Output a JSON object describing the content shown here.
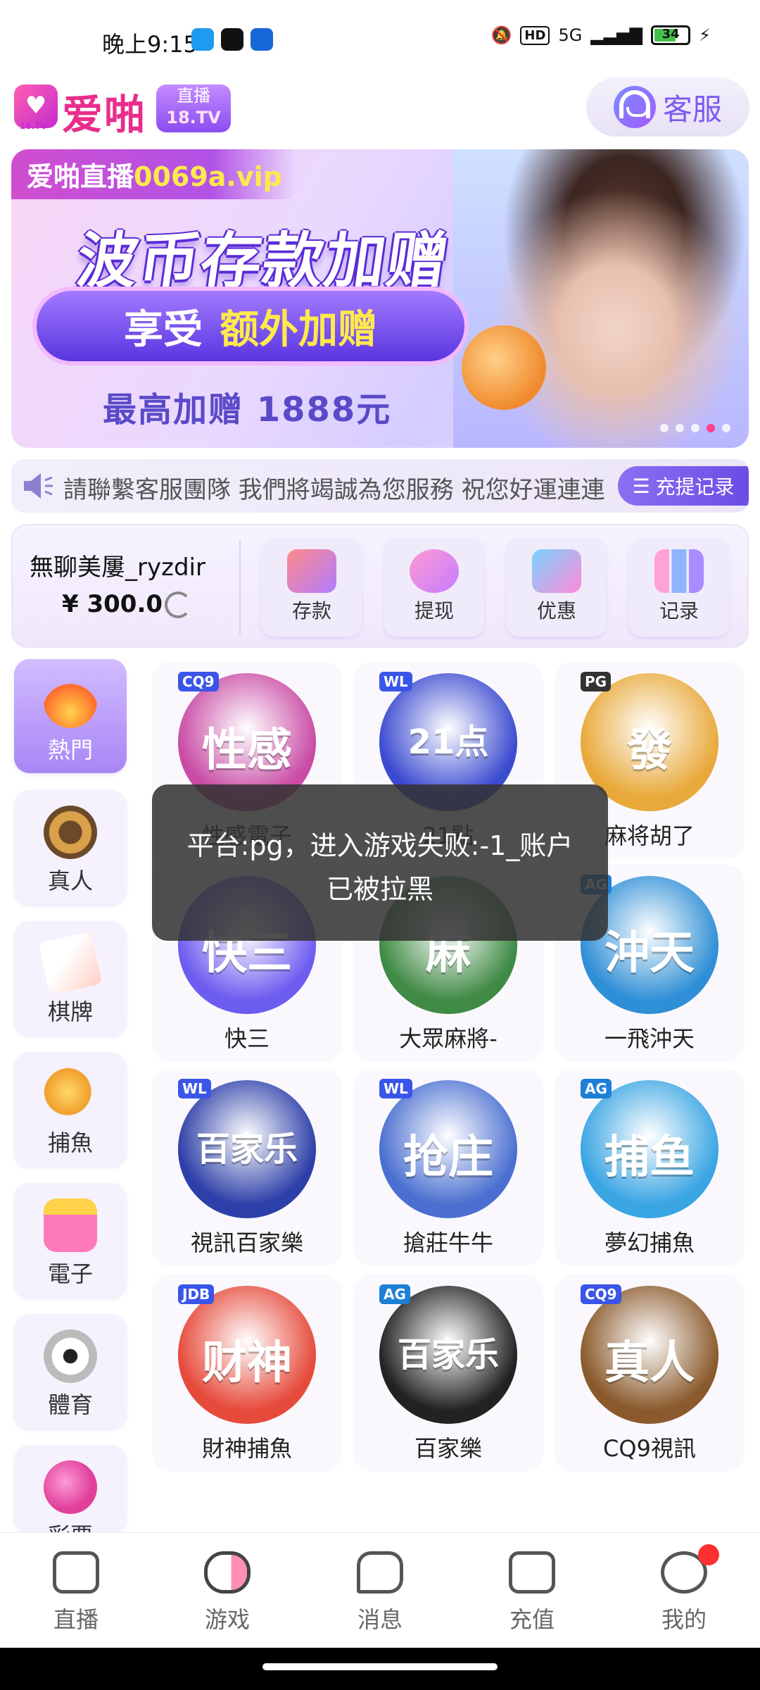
{
  "status_bar": {
    "time": "晚上9:15",
    "network": "5G",
    "hd": "HD",
    "battery": "34"
  },
  "header": {
    "logo_text": "爱啪",
    "logo_tv": "18.TV",
    "badge_top": "直播",
    "badge_bottom": "18.TV",
    "service_label": "客服"
  },
  "banner": {
    "site_prefix": "爱啪直播",
    "site_url": "0069a.vip",
    "title": "波币存款加赠",
    "pill_text_1": "享受",
    "pill_text_2": "额外加赠",
    "footer": "最高加赠 1888元",
    "slide_count": 5,
    "active_slide": 3
  },
  "marquee": {
    "text": "請聯繫客服團隊 我們將竭誠為您服務 祝您好運連連",
    "record_button": "充提记录"
  },
  "account": {
    "username": "無聊美屢_ryzdir",
    "balance": "¥ 300.0",
    "actions": [
      {
        "label": "存款",
        "icon": "deposit-card-icon"
      },
      {
        "label": "提现",
        "icon": "withdraw-bag-icon"
      },
      {
        "label": "优惠",
        "icon": "gift-icon"
      },
      {
        "label": "记录",
        "icon": "bar-chart-icon"
      }
    ]
  },
  "categories": [
    {
      "label": "熱門",
      "icon": "flame-icon",
      "active": true
    },
    {
      "label": "真人",
      "icon": "casino-chip-icon",
      "active": false
    },
    {
      "label": "棋牌",
      "icon": "playing-card-icon",
      "active": false
    },
    {
      "label": "捕魚",
      "icon": "fish-icon",
      "active": false
    },
    {
      "label": "電子",
      "icon": "slot-machine-icon",
      "active": false
    },
    {
      "label": "體育",
      "icon": "soccer-ball-icon",
      "active": false
    },
    {
      "label": "彩票",
      "icon": "lottery-ball-icon",
      "active": false
    }
  ],
  "games": [
    {
      "label": "性感電子",
      "tag": "CQ9",
      "glyph": "性感",
      "color": "#c94ba5"
    },
    {
      "label": "21點",
      "tag": "WL",
      "glyph": "21点",
      "color": "#3b4bd0"
    },
    {
      "label": "麻将胡了",
      "tag": "PG",
      "glyph": "發",
      "color": "#e8a93a"
    },
    {
      "label": "快三",
      "tag": "",
      "glyph": "快三",
      "color": "#6d5cf0"
    },
    {
      "label": "大眾麻將-",
      "tag": "",
      "glyph": "麻",
      "color": "#3f8a44"
    },
    {
      "label": "一飛沖天",
      "tag": "AG",
      "glyph": "沖天",
      "color": "#2f8fd6"
    },
    {
      "label": "視訊百家樂",
      "tag": "WL",
      "glyph": "百家乐",
      "color": "#2d3fa8"
    },
    {
      "label": "搶莊牛牛",
      "tag": "WL",
      "glyph": "抢庄",
      "color": "#4a6fd0"
    },
    {
      "label": "夢幻捕魚",
      "tag": "AG",
      "glyph": "捕鱼",
      "color": "#3aa5e3"
    },
    {
      "label": "財神捕魚",
      "tag": "JDB",
      "glyph": "财神",
      "color": "#e64a3b"
    },
    {
      "label": "百家樂",
      "tag": "AG",
      "glyph": "百家乐",
      "color": "#222222"
    },
    {
      "label": "CQ9視訊",
      "tag": "CQ9",
      "glyph": "真人",
      "color": "#8a5a2c"
    }
  ],
  "toast": {
    "message": "平台:pg，进入游戏失败:-1_账户已被拉黑"
  },
  "bottom_nav": [
    {
      "label": "直播",
      "icon": "video-camera-icon"
    },
    {
      "label": "游戏",
      "icon": "gamepad-icon"
    },
    {
      "label": "消息",
      "icon": "chat-bubble-icon"
    },
    {
      "label": "充值",
      "icon": "wallet-icon"
    },
    {
      "label": "我的",
      "icon": "smiley-face-icon"
    }
  ],
  "colors": {
    "accent": "#7b5bf0",
    "brand_pink": "#e82e8c",
    "toast_bg": "#323232"
  }
}
